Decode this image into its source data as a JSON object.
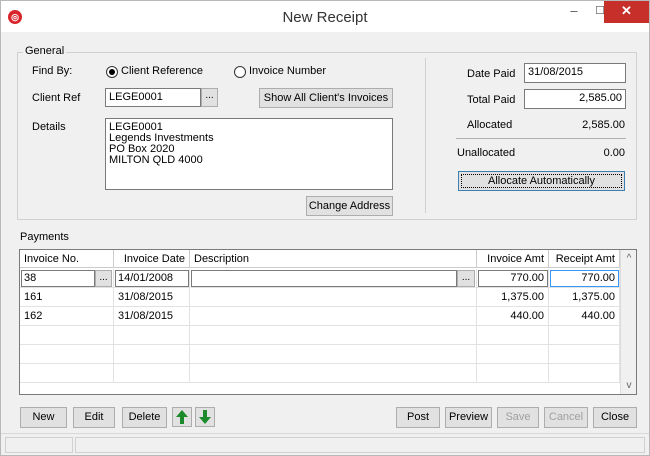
{
  "window": {
    "title": "New Receipt",
    "minimize_glyph": "–",
    "maximize_glyph": "☐",
    "close_glyph": "✕",
    "app_icon_glyph": "◎"
  },
  "general": {
    "group_label": "General",
    "find_by_label": "Find By:",
    "option_client_reference": "Client Reference",
    "option_invoice_number": "Invoice Number",
    "selected_option": "client_reference",
    "client_ref_label": "Client Ref",
    "client_ref_value": "LEGE0001",
    "lookup_button": "...",
    "show_all_button": "Show All Client's Invoices",
    "details_label": "Details",
    "details_lines": [
      "LEGE0001",
      "Legends Investments",
      "PO Box 2020",
      "MILTON QLD 4000"
    ],
    "change_address_button": "Change Address"
  },
  "totals": {
    "date_paid_label": "Date Paid",
    "date_paid_value": "31/08/2015",
    "total_paid_label": "Total Paid",
    "total_paid_value": "2,585.00",
    "allocated_label": "Allocated",
    "allocated_value": "2,585.00",
    "unallocated_label": "Unallocated",
    "unallocated_value": "0.00",
    "allocate_button": "Allocate Automatically"
  },
  "payments": {
    "group_label": "Payments",
    "columns": [
      "Invoice No.",
      "Invoice Date",
      "Description",
      "Invoice Amt",
      "Receipt Amt"
    ],
    "rows": [
      {
        "invoice_no": "38",
        "invoice_date": "14/01/2008",
        "description": "",
        "invoice_amt": "770.00",
        "receipt_amt": "770.00"
      },
      {
        "invoice_no": "161",
        "invoice_date": "31/08/2015",
        "description": "",
        "invoice_amt": "1,375.00",
        "receipt_amt": "1,375.00"
      },
      {
        "invoice_no": "162",
        "invoice_date": "31/08/2015",
        "description": "",
        "invoice_amt": "440.00",
        "receipt_amt": "440.00"
      }
    ],
    "cell_button": "...",
    "scroll_up_glyph": "^",
    "scroll_down_glyph": "v"
  },
  "buttons": {
    "new": "New",
    "edit": "Edit",
    "delete": "Delete",
    "post": "Post",
    "preview": "Preview",
    "save": "Save",
    "cancel": "Cancel",
    "close": "Close"
  },
  "colors": {
    "arrow_green": "#1c8a2a",
    "close_red": "#c7302a",
    "selection_blue": "#3399ff"
  }
}
